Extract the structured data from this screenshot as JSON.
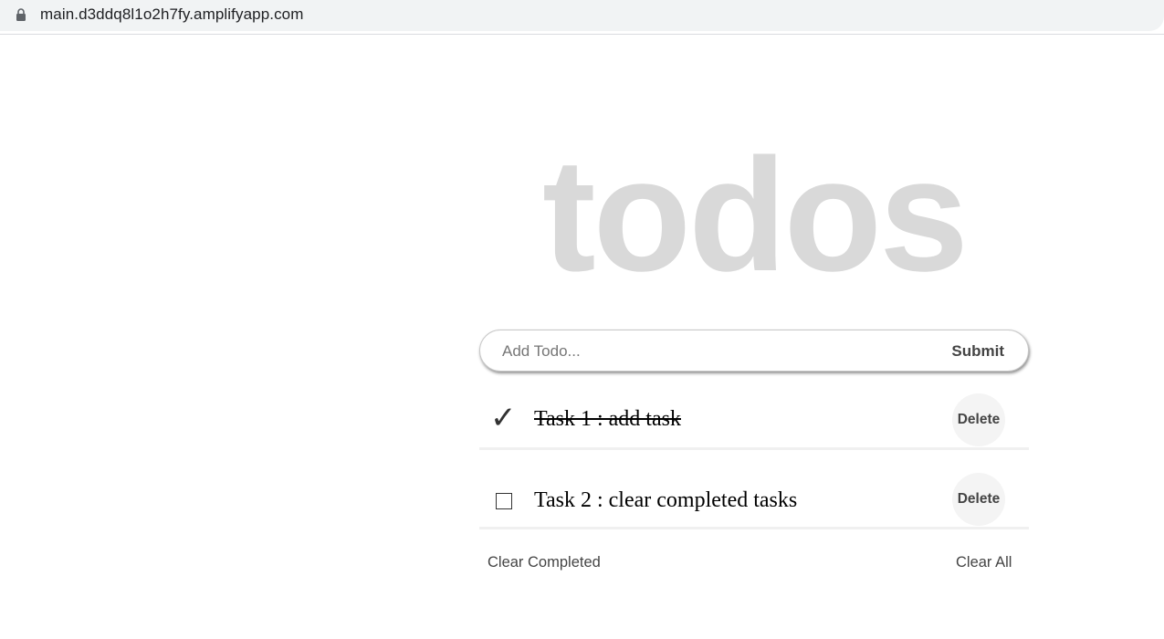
{
  "browser": {
    "url": "main.d3ddq8l1o2h7fy.amplifyapp.com",
    "lock_icon": "lock-icon"
  },
  "app": {
    "title": "todos",
    "title_color": "#d9d9d9"
  },
  "form": {
    "input_placeholder": "Add Todo...",
    "input_value": "",
    "submit_label": "Submit"
  },
  "todos": [
    {
      "text": "Task 1 : add task",
      "completed": true,
      "status_icon": "checkmark-icon",
      "delete_label": "Delete"
    },
    {
      "text": "Task 2 : clear completed tasks",
      "completed": false,
      "status_icon": "checkbox-icon",
      "delete_label": "Delete"
    }
  ],
  "footer": {
    "clear_completed_label": "Clear Completed",
    "clear_all_label": "Clear All"
  }
}
